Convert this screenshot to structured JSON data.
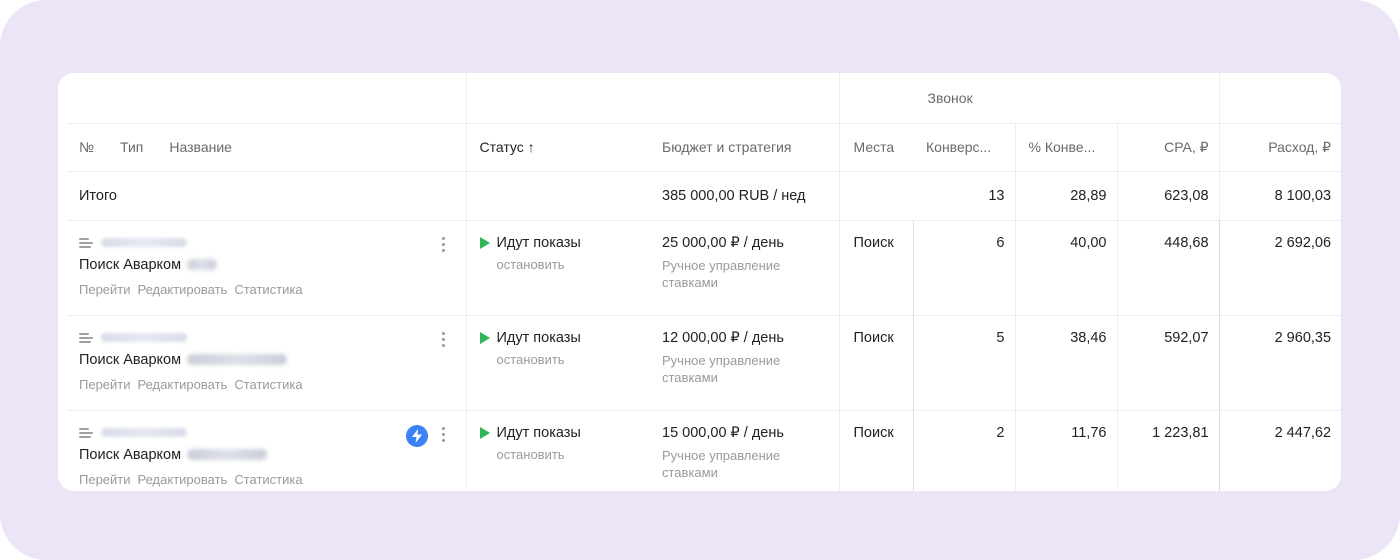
{
  "group_header": {
    "label": "Звонок"
  },
  "columns": {
    "num": "№",
    "type": "Тип",
    "name": "Название",
    "status": "Статус ↑",
    "budget": "Бюджет и стратегия",
    "places": "Места",
    "conversions": "Конверс...",
    "conv_rate": "% Конве...",
    "cpa": "CPA, ₽",
    "spend": "Расход, ₽"
  },
  "total": {
    "label": "Итого",
    "budget": "385 000,00 RUB / нед",
    "conversions": "13",
    "conv_rate": "28,89",
    "cpa": "623,08",
    "spend": "8 100,03"
  },
  "rows": [
    {
      "name": "Поиск Аварком",
      "links": {
        "go": "Перейти",
        "edit": "Редактировать",
        "stats": "Статистика"
      },
      "status": "Идут показы",
      "status_action": "остановить",
      "budget": "25 000,00 ₽ / день",
      "strategy": "Ручное управление ставками",
      "place": "Поиск",
      "conversions": "6",
      "conv_rate": "40,00",
      "cpa": "448,68",
      "spend": "2 692,06",
      "has_bolt": false
    },
    {
      "name": "Поиск Аварком",
      "links": {
        "go": "Перейти",
        "edit": "Редактировать",
        "stats": "Статистика"
      },
      "status": "Идут показы",
      "status_action": "остановить",
      "budget": "12 000,00 ₽ / день",
      "strategy": "Ручное управление ставками",
      "place": "Поиск",
      "conversions": "5",
      "conv_rate": "38,46",
      "cpa": "592,07",
      "spend": "2 960,35",
      "has_bolt": false
    },
    {
      "name": "Поиск Аварком",
      "links": {
        "go": "Перейти",
        "edit": "Редактировать",
        "stats": "Статистика"
      },
      "status": "Идут показы",
      "status_action": "остановить",
      "budget": "15 000,00 ₽ / день",
      "strategy": "Ручное управление ставками",
      "place": "Поиск",
      "conversions": "2",
      "conv_rate": "11,76",
      "cpa": "1 223,81",
      "spend": "2 447,62",
      "has_bolt": true
    }
  ],
  "colors": {
    "background": "#ece5f8",
    "status_active": "#2fb457",
    "bolt_badge": "#3b82f6"
  },
  "icons": {
    "type": "campaign-type-text-icon",
    "status": "play-icon",
    "menu": "kebab-menu-icon",
    "badge": "lightning-bolt-icon"
  }
}
